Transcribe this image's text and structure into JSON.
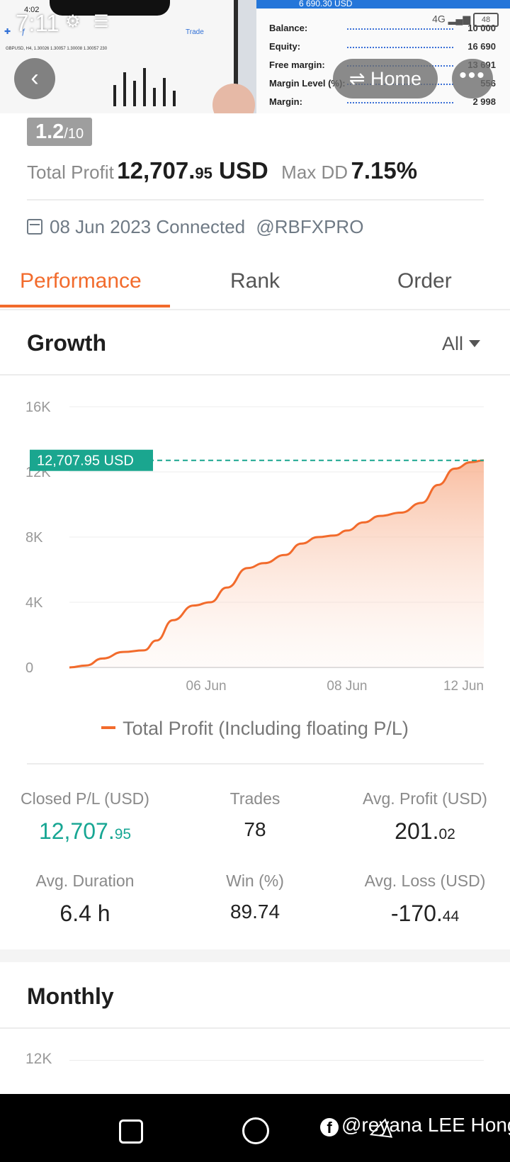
{
  "status_bar": {
    "time": "7:11",
    "network": "4G",
    "battery": "48"
  },
  "banner": {
    "phone": {
      "time": "4:02",
      "trade_label": "Trade",
      "pair": "GBPUSD, H4, 1.30026 1.30057 1.30008 1.30057 230"
    },
    "account": {
      "header": "6 690.30 USD",
      "rows": [
        {
          "label": "Balance:",
          "value": "10 000"
        },
        {
          "label": "Equity:",
          "value": "16 690"
        },
        {
          "label": "Free margin:",
          "value": "13 691"
        },
        {
          "label": "Margin Level (%):",
          "value": "556"
        },
        {
          "label": "Margin:",
          "value": "2 998"
        }
      ]
    }
  },
  "nav": {
    "back_glyph": "‹",
    "home_label": "⇌ Home",
    "more_glyph": "•••"
  },
  "summary": {
    "rating_value": "1.2",
    "rating_max": "/10",
    "total_profit_label": "Total Profit",
    "total_profit_int": "12,707.",
    "total_profit_dec": "95",
    "total_profit_unit": " USD",
    "max_dd_label": "Max DD",
    "max_dd_value": "7.15%",
    "connected_text": "08 Jun 2023 Connected",
    "handle": "@RBFXPRO"
  },
  "tabs": [
    {
      "label": "Performance",
      "active": true
    },
    {
      "label": "Rank",
      "active": false
    },
    {
      "label": "Order",
      "active": false
    }
  ],
  "growth": {
    "title": "Growth",
    "filter": "All",
    "legend": "Total Profit (Including floating P/L)",
    "current_label": "12,707.95 USD"
  },
  "chart_data": {
    "type": "area",
    "title": "",
    "y_ticks": [
      "0",
      "4K",
      "8K",
      "12K",
      "16K"
    ],
    "ylim": [
      0,
      16000
    ],
    "x_ticks": [
      "06 Jun",
      "08 Jun",
      "12 Jun"
    ],
    "x_tick_positions": [
      0.33,
      0.67,
      1.0
    ],
    "series": [
      {
        "name": "Total Profit (Including floating P/L)",
        "color": "#f26b2c",
        "x": [
          0.0,
          0.04,
          0.08,
          0.13,
          0.18,
          0.21,
          0.25,
          0.3,
          0.34,
          0.38,
          0.43,
          0.47,
          0.52,
          0.56,
          0.6,
          0.64,
          0.67,
          0.71,
          0.75,
          0.8,
          0.85,
          0.89,
          0.93,
          0.97,
          1.0
        ],
        "values": [
          0,
          120,
          550,
          950,
          1050,
          1650,
          2900,
          3800,
          4000,
          4900,
          6100,
          6400,
          6900,
          7600,
          8000,
          8100,
          8400,
          8900,
          9300,
          9500,
          10100,
          11200,
          12200,
          12600,
          12707.95
        ]
      }
    ],
    "reference_line": {
      "value": 12707.95,
      "color": "#1aa68f"
    },
    "grid": true
  },
  "stats": [
    {
      "label": "Closed P/L (USD)",
      "int": "12,707.",
      "dec": "95",
      "color": "green"
    },
    {
      "label": "Trades",
      "int": "78",
      "dec": "",
      "color": ""
    },
    {
      "label": "Avg. Profit (USD)",
      "int": "201.",
      "dec": "02",
      "color": ""
    },
    {
      "label": "Avg. Duration",
      "int": "6.4 h",
      "dec": "",
      "color": ""
    },
    {
      "label": "Win (%)",
      "int": "89.74",
      "dec": "",
      "color": ""
    },
    {
      "label": "Avg. Loss (USD)",
      "int": "-170.",
      "dec": "44",
      "color": ""
    }
  ],
  "monthly": {
    "title": "Monthly",
    "first_tick": "12K"
  },
  "watermark": {
    "fb_glyph": "f",
    "text": "@reyana LEE Hong"
  }
}
